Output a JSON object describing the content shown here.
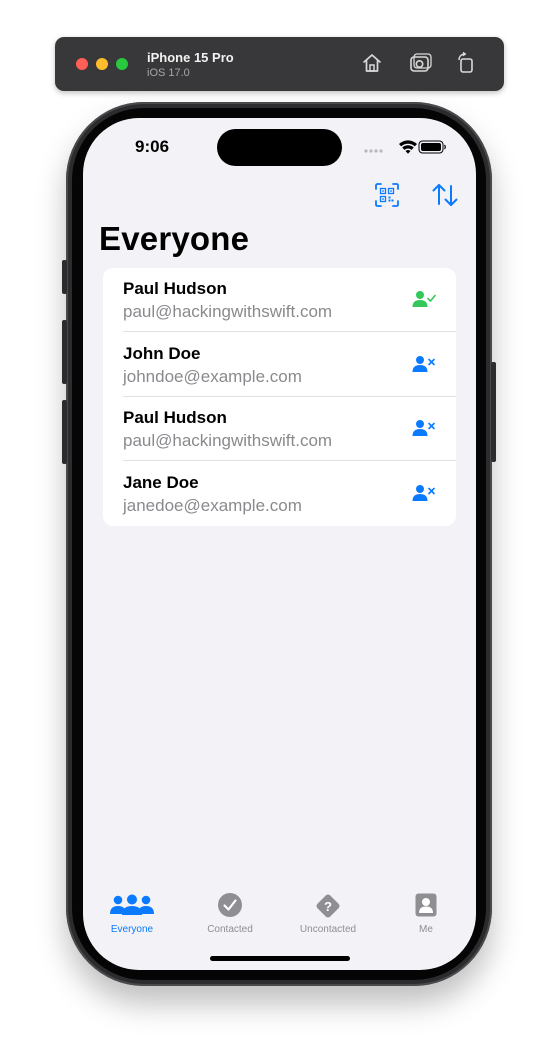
{
  "simulator": {
    "device_name": "iPhone 15 Pro",
    "os_version": "iOS 17.0"
  },
  "status_bar": {
    "time": "9:06"
  },
  "nav": {
    "title": "Everyone",
    "actions": [
      "qr-scan-icon",
      "sort-arrows-icon"
    ]
  },
  "contacts": [
    {
      "name": "Paul Hudson",
      "email": "paul@hackingwithswift.com",
      "status": "contacted",
      "icon": "person-check-icon"
    },
    {
      "name": "John Doe",
      "email": "johndoe@example.com",
      "status": "uncontacted",
      "icon": "person-x-icon"
    },
    {
      "name": "Paul Hudson",
      "email": "paul@hackingwithswift.com",
      "status": "uncontacted",
      "icon": "person-x-icon"
    },
    {
      "name": "Jane Doe",
      "email": "janedoe@example.com",
      "status": "uncontacted",
      "icon": "person-x-icon"
    }
  ],
  "tabs": [
    {
      "label": "Everyone",
      "icon": "people-icon",
      "selected": true
    },
    {
      "label": "Contacted",
      "icon": "checkmark-circle-icon",
      "selected": false
    },
    {
      "label": "Uncontacted",
      "icon": "questionmark-diamond-icon",
      "selected": false
    },
    {
      "label": "Me",
      "icon": "person-square-icon",
      "selected": false
    }
  ],
  "colors": {
    "accent": "#0a7aff",
    "contacted_green": "#34c759",
    "inactive_gray": "#8e8e93",
    "background": "#f2f2f7"
  }
}
